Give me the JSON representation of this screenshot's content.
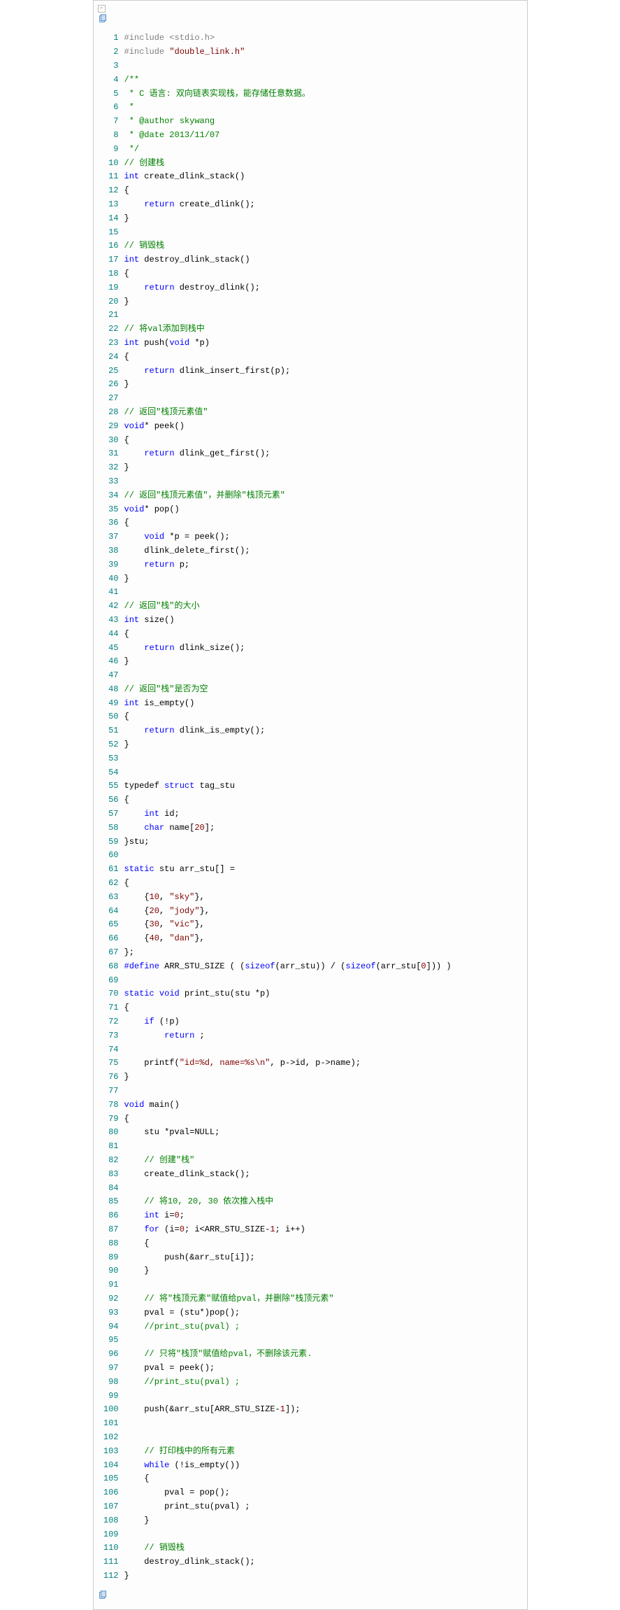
{
  "icons": {
    "collapse": "⊟",
    "copy": "📋"
  },
  "code": {
    "lines": [
      {
        "n": 1,
        "h": "#include &lt;stdio.h&gt;",
        "k": "pp"
      },
      {
        "n": 2,
        "h": "#include <span class='str'>\"double_link.h\"</span>",
        "k": "pp"
      },
      {
        "n": 3,
        "h": ""
      },
      {
        "n": 4,
        "h": "<span class='cmt'>/**</span>"
      },
      {
        "n": 5,
        "h": "<span class='cmt'> * C 语言: 双向链表实现栈，能存储任意数据。</span>"
      },
      {
        "n": 6,
        "h": "<span class='cmt'> *</span>"
      },
      {
        "n": 7,
        "h": "<span class='cmt'> * @author skywang</span>"
      },
      {
        "n": 8,
        "h": "<span class='cmt'> * @date 2013/11/07</span>"
      },
      {
        "n": 9,
        "h": "<span class='cmt'> */</span>"
      },
      {
        "n": 10,
        "h": "<span class='cmt'>// 创建栈</span>"
      },
      {
        "n": 11,
        "h": "<span class='kw'>int</span> create_dlink_stack()"
      },
      {
        "n": 12,
        "h": "{"
      },
      {
        "n": 13,
        "h": "    <span class='kw'>return</span> create_dlink();"
      },
      {
        "n": 14,
        "h": "}"
      },
      {
        "n": 15,
        "h": ""
      },
      {
        "n": 16,
        "h": "<span class='cmt'>// 销毁栈</span>"
      },
      {
        "n": 17,
        "h": "<span class='kw'>int</span> destroy_dlink_stack()"
      },
      {
        "n": 18,
        "h": "{"
      },
      {
        "n": 19,
        "h": "    <span class='kw'>return</span> destroy_dlink();"
      },
      {
        "n": 20,
        "h": "}"
      },
      {
        "n": 21,
        "h": ""
      },
      {
        "n": 22,
        "h": "<span class='cmt'>// 将val添加到栈中</span>"
      },
      {
        "n": 23,
        "h": "<span class='kw'>int</span> push(<span class='kw'>void</span> *p)"
      },
      {
        "n": 24,
        "h": "{"
      },
      {
        "n": 25,
        "h": "    <span class='kw'>return</span> dlink_insert_first(p);"
      },
      {
        "n": 26,
        "h": "}"
      },
      {
        "n": 27,
        "h": ""
      },
      {
        "n": 28,
        "h": "<span class='cmt'>// 返回\"栈顶元素值\"</span>"
      },
      {
        "n": 29,
        "h": "<span class='kw'>void</span>* peek()"
      },
      {
        "n": 30,
        "h": "{"
      },
      {
        "n": 31,
        "h": "    <span class='kw'>return</span> dlink_get_first();"
      },
      {
        "n": 32,
        "h": "}"
      },
      {
        "n": 33,
        "h": ""
      },
      {
        "n": 34,
        "h": "<span class='cmt'>// 返回\"栈顶元素值\"，并删除\"栈顶元素\"</span>"
      },
      {
        "n": 35,
        "h": "<span class='kw'>void</span>* pop()"
      },
      {
        "n": 36,
        "h": "{"
      },
      {
        "n": 37,
        "h": "    <span class='kw'>void</span> *p = peek();"
      },
      {
        "n": 38,
        "h": "    dlink_delete_first();"
      },
      {
        "n": 39,
        "h": "    <span class='kw'>return</span> p;"
      },
      {
        "n": 40,
        "h": "}"
      },
      {
        "n": 41,
        "h": ""
      },
      {
        "n": 42,
        "h": "<span class='cmt'>// 返回\"栈\"的大小</span>"
      },
      {
        "n": 43,
        "h": "<span class='kw'>int</span> size()"
      },
      {
        "n": 44,
        "h": "{"
      },
      {
        "n": 45,
        "h": "    <span class='kw'>return</span> dlink_size();"
      },
      {
        "n": 46,
        "h": "}"
      },
      {
        "n": 47,
        "h": ""
      },
      {
        "n": 48,
        "h": "<span class='cmt'>// 返回\"栈\"是否为空</span>"
      },
      {
        "n": 49,
        "h": "<span class='kw'>int</span> is_empty()"
      },
      {
        "n": 50,
        "h": "{"
      },
      {
        "n": 51,
        "h": "    <span class='kw'>return</span> dlink_is_empty();"
      },
      {
        "n": 52,
        "h": "}"
      },
      {
        "n": 53,
        "h": ""
      },
      {
        "n": 54,
        "h": ""
      },
      {
        "n": 55,
        "h": "typedef <span class='kw'>struct</span> tag_stu"
      },
      {
        "n": 56,
        "h": "{"
      },
      {
        "n": 57,
        "h": "    <span class='kw'>int</span> id;"
      },
      {
        "n": 58,
        "h": "    <span class='kw'>char</span> name[<span class='num'>20</span>];"
      },
      {
        "n": 59,
        "h": "}stu;"
      },
      {
        "n": 60,
        "h": ""
      },
      {
        "n": 61,
        "h": "<span class='kw'>static</span> stu arr_stu[] ="
      },
      {
        "n": 62,
        "h": "{"
      },
      {
        "n": 63,
        "h": "    {<span class='num'>10</span>, <span class='str'>\"sky\"</span>},"
      },
      {
        "n": 64,
        "h": "    {<span class='num'>20</span>, <span class='str'>\"jody\"</span>},"
      },
      {
        "n": 65,
        "h": "    {<span class='num'>30</span>, <span class='str'>\"vic\"</span>},"
      },
      {
        "n": 66,
        "h": "    {<span class='num'>40</span>, <span class='str'>\"dan\"</span>},"
      },
      {
        "n": 67,
        "h": "};"
      },
      {
        "n": 68,
        "h": "<span class='kw'>#define</span> ARR_STU_SIZE ( (<span class='kw'>sizeof</span>(arr_stu)) / (<span class='kw'>sizeof</span>(arr_stu[<span class='num'>0</span>])) )"
      },
      {
        "n": 69,
        "h": ""
      },
      {
        "n": 70,
        "h": "<span class='kw'>static</span> <span class='kw'>void</span> print_stu(stu *p)"
      },
      {
        "n": 71,
        "h": "{"
      },
      {
        "n": 72,
        "h": "    <span class='kw'>if</span> (!p)"
      },
      {
        "n": 73,
        "h": "        <span class='kw'>return</span> ;"
      },
      {
        "n": 74,
        "h": ""
      },
      {
        "n": 75,
        "h": "    printf(<span class='str'>\"id=%d, name=%s\\n\"</span>, p-&gt;id, p-&gt;name);"
      },
      {
        "n": 76,
        "h": "}"
      },
      {
        "n": 77,
        "h": ""
      },
      {
        "n": 78,
        "h": "<span class='kw'>void</span> main()"
      },
      {
        "n": 79,
        "h": "{"
      },
      {
        "n": 80,
        "h": "    stu *pval=NULL;"
      },
      {
        "n": 81,
        "h": ""
      },
      {
        "n": 82,
        "h": "    <span class='cmt'>// 创建\"栈\"</span>"
      },
      {
        "n": 83,
        "h": "    create_dlink_stack();"
      },
      {
        "n": 84,
        "h": ""
      },
      {
        "n": 85,
        "h": "    <span class='cmt'>// 将10, 20, 30 依次推入栈中</span>"
      },
      {
        "n": 86,
        "h": "    <span class='kw'>int</span> i=<span class='num'>0</span>;"
      },
      {
        "n": 87,
        "h": "    <span class='kw'>for</span> (i=<span class='num'>0</span>; i&lt;ARR_STU_SIZE-<span class='num'>1</span>; i++)"
      },
      {
        "n": 88,
        "h": "    {"
      },
      {
        "n": 89,
        "h": "        push(&amp;arr_stu[i]);"
      },
      {
        "n": 90,
        "h": "    }"
      },
      {
        "n": 91,
        "h": ""
      },
      {
        "n": 92,
        "h": "    <span class='cmt'>// 将\"栈顶元素\"赋值给pval，并删除\"栈顶元素\"</span>"
      },
      {
        "n": 93,
        "h": "    pval = (stu*)pop();"
      },
      {
        "n": 94,
        "h": "    <span class='cmt'>//print_stu(pval) ;</span>"
      },
      {
        "n": 95,
        "h": ""
      },
      {
        "n": 96,
        "h": "    <span class='cmt'>// 只将\"栈顶\"赋值给pval，不删除该元素.</span>"
      },
      {
        "n": 97,
        "h": "    pval = peek();"
      },
      {
        "n": 98,
        "h": "    <span class='cmt'>//print_stu(pval) ;</span>"
      },
      {
        "n": 99,
        "h": ""
      },
      {
        "n": 100,
        "h": "    push(&amp;arr_stu[ARR_STU_SIZE-<span class='num'>1</span>]);"
      },
      {
        "n": 101,
        "h": ""
      },
      {
        "n": 102,
        "h": ""
      },
      {
        "n": 103,
        "h": "    <span class='cmt'>// 打印栈中的所有元素</span>"
      },
      {
        "n": 104,
        "h": "    <span class='kw'>while</span> (!is_empty())"
      },
      {
        "n": 105,
        "h": "    {"
      },
      {
        "n": 106,
        "h": "        pval = pop();"
      },
      {
        "n": 107,
        "h": "        print_stu(pval) ;"
      },
      {
        "n": 108,
        "h": "    }"
      },
      {
        "n": 109,
        "h": ""
      },
      {
        "n": 110,
        "h": "    <span class='cmt'>// 销毁栈</span>"
      },
      {
        "n": 111,
        "h": "    destroy_dlink_stack();"
      },
      {
        "n": 112,
        "h": "}"
      }
    ]
  }
}
